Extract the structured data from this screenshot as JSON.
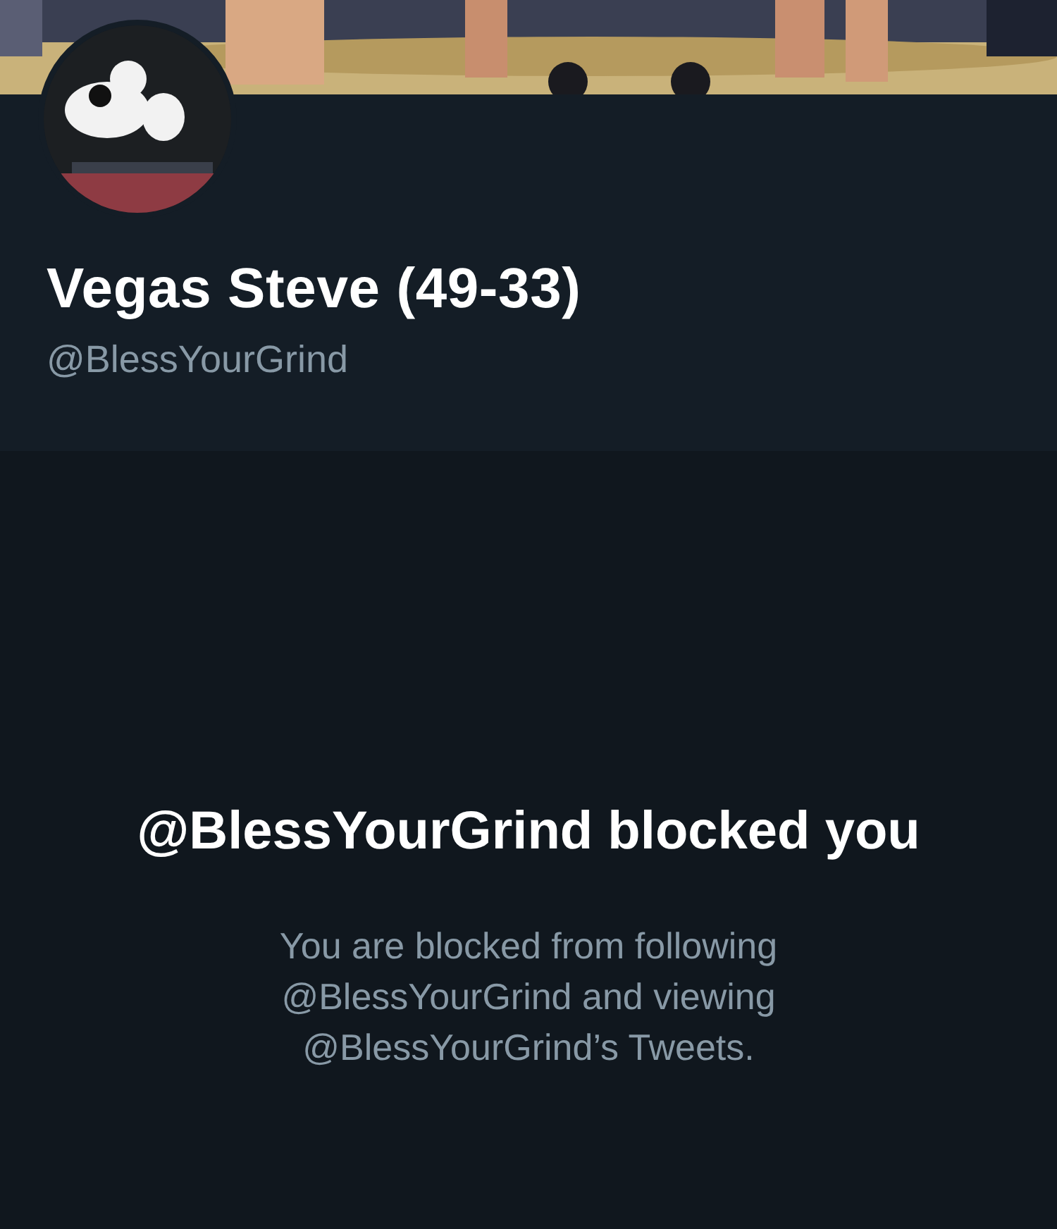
{
  "profile": {
    "name": "Vegas Steve (49-33)",
    "handle": "@BlessYourGrind"
  },
  "blocked_notice": {
    "title": "@BlessYourGrind blocked you",
    "message": "You are blocked from following @BlessYourGrind and viewing @BlessYourGrind’s Tweets."
  }
}
